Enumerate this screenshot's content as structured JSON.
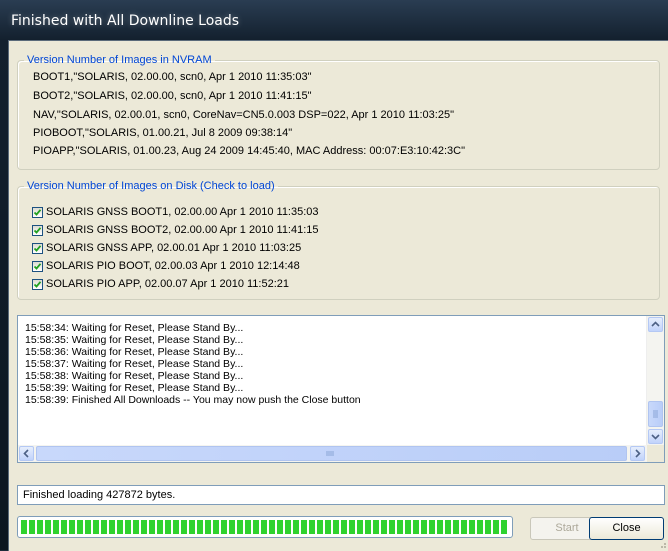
{
  "window": {
    "title": "Finished with All Downline Loads"
  },
  "nvram": {
    "legend": "Version Number of Images in NVRAM",
    "lines": [
      "BOOT1,\"SOLARIS, 02.00.00, scn0, Apr  1 2010 11:35:03\"",
      "BOOT2,\"SOLARIS, 02.00.00, scn0, Apr  1 2010 11:41:15\"",
      "NAV,\"SOLARIS, 02.00.01, scn0, CoreNav=CN5.0.003 DSP=022, Apr  1 2010 11:03:25\"",
      "PIOBOOT,\"SOLARIS, 01.00.21, Jul  8 2009 09:38:14\"",
      "PIOAPP,\"SOLARIS, 01.00.23, Aug 24 2009 14:45:40, MAC Address: 00:07:E3:10:42:3C\""
    ]
  },
  "disk": {
    "legend": "Version Number of Images on Disk (Check to load)",
    "items": [
      {
        "label": "SOLARIS  GNSS BOOT1, 02.00.00 Apr  1 2010 11:35:03",
        "checked": true
      },
      {
        "label": "SOLARIS  GNSS BOOT2, 02.00.00 Apr  1 2010 11:41:15",
        "checked": true
      },
      {
        "label": "SOLARIS  GNSS APP, 02.00.01 Apr  1 2010 11:03:25",
        "checked": true
      },
      {
        "label": "SOLARIS  PIO BOOT, 02.00.03 Apr  1 2010 12:14:48",
        "checked": true
      },
      {
        "label": "SOLARIS  PIO APP, 02.00.07 Apr  1 2010 11:52:21",
        "checked": true
      }
    ]
  },
  "log": {
    "lines": [
      "15:58:34: Waiting for Reset, Please Stand By...",
      "15:58:35: Waiting for Reset, Please Stand By...",
      "15:58:36: Waiting for Reset, Please Stand By...",
      "15:58:37: Waiting for Reset, Please Stand By...",
      "15:58:38: Waiting for Reset, Please Stand By...",
      "15:58:39: Waiting for Reset, Please Stand By...",
      "15:58:39: Finished All Downloads -- You may now push the Close button"
    ]
  },
  "status": {
    "text": "Finished loading 427872 bytes."
  },
  "progress": {
    "percent": 100,
    "color": "#2fd22f"
  },
  "buttons": {
    "start": "Start",
    "close": "Close"
  }
}
